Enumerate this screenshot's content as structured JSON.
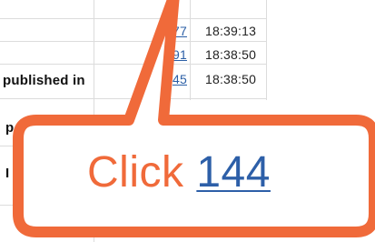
{
  "table": {
    "rows": [
      {
        "link_fragment": "77",
        "time": "18:39:13"
      },
      {
        "link_fragment": "91",
        "time": "18:38:50"
      },
      {
        "title_fragment": "published in",
        "link_fragment": "45",
        "time": "18:38:50"
      }
    ],
    "partial_labels": [
      "p",
      "I"
    ]
  },
  "callout": {
    "action_word": "Click",
    "target_number": "144",
    "colors": {
      "border": "#f06a3a",
      "word": "#f06a3a",
      "link": "#2d5fa8"
    }
  }
}
